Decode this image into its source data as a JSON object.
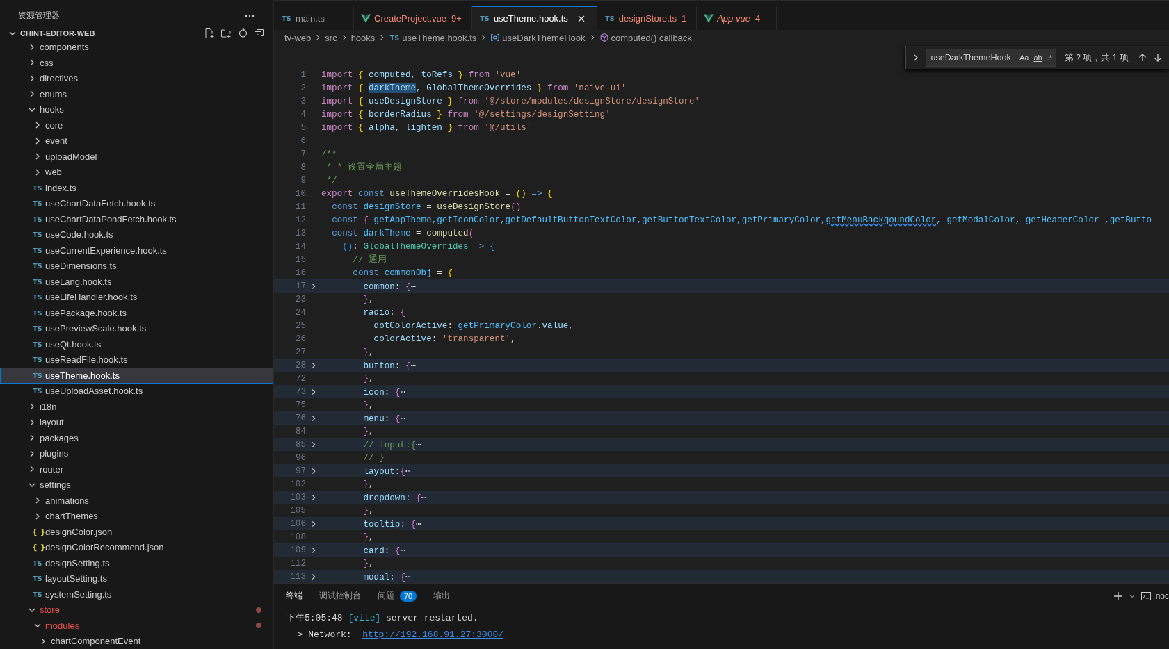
{
  "explorer": {
    "title": "资源管理器",
    "root": {
      "label": "CHINT-EDITOR-WEB",
      "expanded": true
    },
    "tree": [
      {
        "label": "components",
        "kind": "folder",
        "expanded": false,
        "selected": false,
        "modified": false
      },
      {
        "label": "css",
        "kind": "folder",
        "expanded": false,
        "selected": false,
        "modified": false
      },
      {
        "label": "directives",
        "kind": "folder",
        "expanded": false,
        "selected": false,
        "modified": false
      },
      {
        "label": "enums",
        "kind": "folder",
        "expanded": false,
        "selected": false,
        "modified": false
      },
      {
        "label": "hooks",
        "kind": "folder",
        "expanded": true,
        "selected": false,
        "modified": false,
        "children": [
          {
            "label": "core",
            "kind": "folder",
            "expanded": false,
            "selected": false,
            "modified": false
          },
          {
            "label": "event",
            "kind": "folder",
            "expanded": false,
            "selected": false,
            "modified": false
          },
          {
            "label": "uploadModel",
            "kind": "folder",
            "expanded": false,
            "selected": false,
            "modified": false
          },
          {
            "label": "web",
            "kind": "folder",
            "expanded": false,
            "selected": false,
            "modified": false
          },
          {
            "label": "index.ts",
            "kind": "ts",
            "icon": "TS",
            "selected": false,
            "modified": false
          },
          {
            "label": "useChartDataFetch.hook.ts",
            "kind": "ts",
            "icon": "TS",
            "selected": false,
            "modified": false
          },
          {
            "label": "useChartDataPondFetch.hook.ts",
            "kind": "ts",
            "icon": "TS",
            "selected": false,
            "modified": false
          },
          {
            "label": "useCode.hook.ts",
            "kind": "ts",
            "icon": "TS",
            "selected": false,
            "modified": false
          },
          {
            "label": "useCurrentExperience.hook.ts",
            "kind": "ts",
            "icon": "TS",
            "selected": false,
            "modified": false
          },
          {
            "label": "useDimensions.ts",
            "kind": "ts",
            "icon": "TS",
            "selected": false,
            "modified": false
          },
          {
            "label": "useLang.hook.ts",
            "kind": "ts",
            "icon": "TS",
            "selected": false,
            "modified": false
          },
          {
            "label": "useLifeHandler.hook.ts",
            "kind": "ts",
            "icon": "TS",
            "selected": false,
            "modified": false
          },
          {
            "label": "usePackage.hook.ts",
            "kind": "ts",
            "icon": "TS",
            "selected": false,
            "modified": false
          },
          {
            "label": "usePreviewScale.hook.ts",
            "kind": "ts",
            "icon": "TS",
            "selected": false,
            "modified": false
          },
          {
            "label": "useQt.hook.ts",
            "kind": "ts",
            "icon": "TS",
            "selected": false,
            "modified": false
          },
          {
            "label": "useReadFile.hook.ts",
            "kind": "ts",
            "icon": "TS",
            "selected": false,
            "modified": false
          },
          {
            "label": "useTheme.hook.ts",
            "kind": "ts",
            "icon": "TS",
            "selected": true,
            "modified": false
          },
          {
            "label": "useUploadAsset.hook.ts",
            "kind": "ts",
            "icon": "TS",
            "selected": false,
            "modified": false
          }
        ]
      },
      {
        "label": "i18n",
        "kind": "folder",
        "expanded": false,
        "selected": false,
        "modified": false
      },
      {
        "label": "layout",
        "kind": "folder",
        "expanded": false,
        "selected": false,
        "modified": false
      },
      {
        "label": "packages",
        "kind": "folder",
        "expanded": false,
        "selected": false,
        "modified": false
      },
      {
        "label": "plugins",
        "kind": "folder",
        "expanded": false,
        "selected": false,
        "modified": false
      },
      {
        "label": "router",
        "kind": "folder",
        "expanded": false,
        "selected": false,
        "modified": false
      },
      {
        "label": "settings",
        "kind": "folder",
        "expanded": true,
        "selected": false,
        "modified": false,
        "children": [
          {
            "label": "animations",
            "kind": "folder",
            "expanded": false,
            "selected": false,
            "modified": false
          },
          {
            "label": "chartThemes",
            "kind": "folder",
            "expanded": false,
            "selected": false,
            "modified": false
          },
          {
            "label": "designColor.json",
            "kind": "json",
            "icon": "{ }",
            "selected": false,
            "modified": false
          },
          {
            "label": "designColorRecommend.json",
            "kind": "json",
            "icon": "{ }",
            "selected": false,
            "modified": false
          },
          {
            "label": "designSetting.ts",
            "kind": "ts",
            "icon": "TS",
            "selected": false,
            "modified": false
          },
          {
            "label": "layoutSetting.ts",
            "kind": "ts",
            "icon": "TS",
            "selected": false,
            "modified": false
          },
          {
            "label": "systemSetting.ts",
            "kind": "ts",
            "icon": "TS",
            "selected": false,
            "modified": false
          }
        ]
      },
      {
        "label": "store",
        "kind": "folder",
        "expanded": true,
        "selected": false,
        "modified": true,
        "children": [
          {
            "label": "modules",
            "kind": "folder",
            "expanded": true,
            "selected": false,
            "modified": true,
            "children": [
              {
                "label": "chartComponentEvent",
                "kind": "folder",
                "expanded": false,
                "selected": false,
                "modified": false
              }
            ]
          }
        ]
      }
    ]
  },
  "tabs": [
    {
      "label": "main.ts",
      "kind": "ts",
      "icon": "TS",
      "selected": false,
      "error": false,
      "preview": false
    },
    {
      "label": "CreateProject.vue",
      "kind": "vue",
      "badge": "9+",
      "selected": false,
      "error": true,
      "preview": false
    },
    {
      "label": "useTheme.hook.ts",
      "kind": "ts",
      "icon": "TS",
      "selected": true,
      "error": false,
      "preview": false
    },
    {
      "label": "designStore.ts",
      "kind": "ts",
      "icon": "TS",
      "badge": "1",
      "selected": false,
      "error": true,
      "preview": false
    },
    {
      "label": "App.vue",
      "kind": "vue",
      "badge": "4",
      "selected": false,
      "error": true,
      "preview": true
    }
  ],
  "breadcrumb": [
    {
      "label": "tv-web",
      "kind": "folder"
    },
    {
      "label": "src",
      "kind": "folder"
    },
    {
      "label": "hooks",
      "kind": "folder"
    },
    {
      "label": "useTheme.hook.ts",
      "kind": "ts",
      "icon": "TS"
    },
    {
      "label": "useDarkThemeHook",
      "kind": "variable"
    },
    {
      "label": "computed() callback",
      "kind": "method"
    }
  ],
  "find": {
    "value": "useDarkThemeHook",
    "options": [
      "Aa",
      "ab",
      ".*"
    ],
    "result": "第？项，共 1 项"
  },
  "editor": {
    "lines": [
      {
        "n": "1",
        "folded": false,
        "tokens": [
          {
            "text": "import ",
            "kind": "kw"
          },
          {
            "text": "{",
            "kind": "b1"
          },
          {
            "text": " computed, toRefs ",
            "kind": "var"
          },
          {
            "text": "}",
            "kind": "b1"
          },
          {
            "text": " from ",
            "kind": "kw"
          },
          {
            "text": "'vue'",
            "kind": "str"
          }
        ]
      },
      {
        "n": "2",
        "folded": false,
        "tokens": [
          {
            "text": "import ",
            "kind": "kw"
          },
          {
            "text": "{ ",
            "kind": "b1"
          },
          {
            "text": "darkTheme",
            "kind": "match"
          },
          {
            "text": ", GlobalThemeOverrides ",
            "kind": "var"
          },
          {
            "text": "}",
            "kind": "b1"
          },
          {
            "text": " from ",
            "kind": "kw"
          },
          {
            "text": "'naive-ui'",
            "kind": "str"
          }
        ]
      },
      {
        "n": "3",
        "folded": false,
        "tokens": [
          {
            "text": "import ",
            "kind": "kw"
          },
          {
            "text": "{",
            "kind": "b1"
          },
          {
            "text": " useDesignStore ",
            "kind": "var"
          },
          {
            "text": "}",
            "kind": "b1"
          },
          {
            "text": " from ",
            "kind": "kw"
          },
          {
            "text": "'@/store/modules/designStore/designStore'",
            "kind": "str"
          }
        ]
      },
      {
        "n": "4",
        "folded": false,
        "tokens": [
          {
            "text": "import ",
            "kind": "kw"
          },
          {
            "text": "{",
            "kind": "b1"
          },
          {
            "text": " borderRadius ",
            "kind": "var"
          },
          {
            "text": "}",
            "kind": "b1"
          },
          {
            "text": " from ",
            "kind": "kw"
          },
          {
            "text": "'@/settings/designSetting'",
            "kind": "str"
          }
        ]
      },
      {
        "n": "5",
        "folded": false,
        "tokens": [
          {
            "text": "import ",
            "kind": "kw"
          },
          {
            "text": "{",
            "kind": "b1"
          },
          {
            "text": " alpha, lighten ",
            "kind": "var"
          },
          {
            "text": "}",
            "kind": "b1"
          },
          {
            "text": " from ",
            "kind": "kw"
          },
          {
            "text": "'@/utils'",
            "kind": "str"
          }
        ]
      },
      {
        "n": "6",
        "folded": false
      },
      {
        "n": "7",
        "folded": false,
        "tokens": [
          {
            "text": "/**",
            "kind": "cm"
          }
        ]
      },
      {
        "n": "8",
        "folded": false,
        "tokens": [
          {
            "text": " * * 设置全局主题",
            "kind": "cm"
          }
        ]
      },
      {
        "n": "9",
        "folded": false,
        "tokens": [
          {
            "text": " */",
            "kind": "cm"
          }
        ]
      },
      {
        "n": "10",
        "folded": false,
        "tokens": [
          {
            "text": "export ",
            "kind": "kw"
          },
          {
            "text": "const ",
            "kind": "st"
          },
          {
            "text": "useThemeOverridesHook",
            "kind": "fn"
          },
          {
            "text": " = ",
            "kind": "p"
          },
          {
            "text": "()",
            "kind": "b1"
          },
          {
            "text": " => ",
            "kind": "st"
          },
          {
            "text": "{",
            "kind": "b1"
          }
        ]
      },
      {
        "n": "11",
        "folded": false,
        "tokens": [
          {
            "text": "  const ",
            "kind": "st"
          },
          {
            "text": "designStore",
            "kind": "const"
          },
          {
            "text": " = ",
            "kind": "p"
          },
          {
            "text": "useDesignStore",
            "kind": "fn"
          },
          {
            "text": "()",
            "kind": "b2"
          }
        ]
      },
      {
        "n": "12",
        "folded": false,
        "tokens": [
          {
            "text": "  const ",
            "kind": "st"
          },
          {
            "text": "{",
            "kind": "b2"
          },
          {
            "text": " getAppTheme,getIconColor,getDefaultButtonTextColor,getButtonTextColor,getPrimaryColor,",
            "kind": "const"
          },
          {
            "text": "getMenuBackgoundColor",
            "kind": "misspelled"
          },
          {
            "text": ", getModalColor, getHeaderColor ,getButto",
            "kind": "const"
          }
        ]
      },
      {
        "n": "13",
        "folded": false,
        "tokens": [
          {
            "text": "  const ",
            "kind": "st"
          },
          {
            "text": "darkTheme",
            "kind": "const"
          },
          {
            "text": " = ",
            "kind": "p"
          },
          {
            "text": "computed",
            "kind": "fn"
          },
          {
            "text": "(",
            "kind": "b2"
          }
        ]
      },
      {
        "n": "14",
        "folded": false,
        "tokens": [
          {
            "text": "    ()",
            "kind": "b3"
          },
          {
            "text": ": ",
            "kind": "p"
          },
          {
            "text": "GlobalThemeOverrides",
            "kind": "type"
          },
          {
            "text": " => ",
            "kind": "st"
          },
          {
            "text": "{",
            "kind": "b3"
          }
        ]
      },
      {
        "n": "15",
        "folded": false,
        "tokens": [
          {
            "text": "      // 通用",
            "kind": "cm"
          }
        ]
      },
      {
        "n": "16",
        "folded": false,
        "tokens": [
          {
            "text": "      const ",
            "kind": "st"
          },
          {
            "text": "commonObj",
            "kind": "const"
          },
          {
            "text": " = ",
            "kind": "p"
          },
          {
            "text": "{",
            "kind": "b1"
          }
        ]
      },
      {
        "n": "17",
        "folded": true,
        "tokens": [
          {
            "text": "        common",
            "kind": "var"
          },
          {
            "text": ": ",
            "kind": "p"
          },
          {
            "text": "{",
            "kind": "b2"
          },
          {
            "text": "⋯",
            "kind": "p"
          }
        ]
      },
      {
        "n": "23",
        "folded": false,
        "tokens": [
          {
            "text": "        }",
            "kind": "b2"
          },
          {
            "text": ",",
            "kind": "p"
          }
        ]
      },
      {
        "n": "24",
        "folded": false,
        "tokens": [
          {
            "text": "        radio",
            "kind": "var"
          },
          {
            "text": ": ",
            "kind": "p"
          },
          {
            "text": "{",
            "kind": "b2"
          }
        ]
      },
      {
        "n": "25",
        "folded": false,
        "tokens": [
          {
            "text": "          dotColorActive",
            "kind": "var"
          },
          {
            "text": ": ",
            "kind": "p"
          },
          {
            "text": "getPrimaryColor",
            "kind": "const"
          },
          {
            "text": ".",
            "kind": "p"
          },
          {
            "text": "value",
            "kind": "var"
          },
          {
            "text": ",",
            "kind": "p"
          }
        ]
      },
      {
        "n": "26",
        "folded": false,
        "tokens": [
          {
            "text": "          colorActive",
            "kind": "var"
          },
          {
            "text": ": ",
            "kind": "p"
          },
          {
            "text": "'transparent'",
            "kind": "str"
          },
          {
            "text": ",",
            "kind": "p"
          }
        ]
      },
      {
        "n": "27",
        "folded": false,
        "tokens": [
          {
            "text": "        }",
            "kind": "b2"
          },
          {
            "text": ",",
            "kind": "p"
          }
        ]
      },
      {
        "n": "28",
        "folded": true,
        "tokens": [
          {
            "text": "        button",
            "kind": "var"
          },
          {
            "text": ": ",
            "kind": "p"
          },
          {
            "text": "{",
            "kind": "b2"
          },
          {
            "text": "⋯",
            "kind": "p"
          }
        ]
      },
      {
        "n": "72",
        "folded": false,
        "tokens": [
          {
            "text": "        }",
            "kind": "b2"
          },
          {
            "text": ",",
            "kind": "p"
          }
        ]
      },
      {
        "n": "73",
        "folded": true,
        "tokens": [
          {
            "text": "        icon",
            "kind": "var"
          },
          {
            "text": ": ",
            "kind": "p"
          },
          {
            "text": "{",
            "kind": "b2"
          },
          {
            "text": "⋯",
            "kind": "p"
          }
        ]
      },
      {
        "n": "75",
        "folded": false,
        "tokens": [
          {
            "text": "        }",
            "kind": "b2"
          },
          {
            "text": ",",
            "kind": "p"
          }
        ]
      },
      {
        "n": "76",
        "folded": true,
        "tokens": [
          {
            "text": "        menu",
            "kind": "var"
          },
          {
            "text": ": ",
            "kind": "p"
          },
          {
            "text": "{",
            "kind": "b2"
          },
          {
            "text": "⋯",
            "kind": "p"
          }
        ]
      },
      {
        "n": "84",
        "folded": false,
        "tokens": [
          {
            "text": "        }",
            "kind": "b2"
          },
          {
            "text": ",",
            "kind": "p"
          }
        ]
      },
      {
        "n": "85",
        "folded": true,
        "tokens": [
          {
            "text": "        // input:{",
            "kind": "cm"
          },
          {
            "text": "⋯",
            "kind": "p"
          }
        ]
      },
      {
        "n": "96",
        "folded": false,
        "tokens": [
          {
            "text": "        // }",
            "kind": "cm"
          }
        ]
      },
      {
        "n": "97",
        "folded": true,
        "tokens": [
          {
            "text": "        layout",
            "kind": "var"
          },
          {
            "text": ":",
            "kind": "p"
          },
          {
            "text": "{",
            "kind": "b2"
          },
          {
            "text": "⋯",
            "kind": "p"
          }
        ]
      },
      {
        "n": "102",
        "folded": false,
        "tokens": [
          {
            "text": "        }",
            "kind": "b2"
          },
          {
            "text": ",",
            "kind": "p"
          }
        ]
      },
      {
        "n": "103",
        "folded": true,
        "tokens": [
          {
            "text": "        dropdown",
            "kind": "var"
          },
          {
            "text": ": ",
            "kind": "p"
          },
          {
            "text": "{",
            "kind": "b2"
          },
          {
            "text": "⋯",
            "kind": "p"
          }
        ]
      },
      {
        "n": "105",
        "folded": false,
        "tokens": [
          {
            "text": "        }",
            "kind": "b2"
          },
          {
            "text": ",",
            "kind": "p"
          }
        ]
      },
      {
        "n": "106",
        "folded": true,
        "tokens": [
          {
            "text": "        tooltip",
            "kind": "var"
          },
          {
            "text": ": ",
            "kind": "p"
          },
          {
            "text": "{",
            "kind": "b2"
          },
          {
            "text": "⋯",
            "kind": "p"
          }
        ]
      },
      {
        "n": "108",
        "folded": false,
        "tokens": [
          {
            "text": "        }",
            "kind": "b2"
          },
          {
            "text": ",",
            "kind": "p"
          }
        ]
      },
      {
        "n": "109",
        "folded": true,
        "tokens": [
          {
            "text": "        card",
            "kind": "var"
          },
          {
            "text": ": ",
            "kind": "p"
          },
          {
            "text": "{",
            "kind": "b2"
          },
          {
            "text": "⋯",
            "kind": "p"
          }
        ]
      },
      {
        "n": "112",
        "folded": false,
        "tokens": [
          {
            "text": "        }",
            "kind": "b2"
          },
          {
            "text": ",",
            "kind": "p"
          }
        ]
      },
      {
        "n": "113",
        "folded": true,
        "tokens": [
          {
            "text": "        modal",
            "kind": "var"
          },
          {
            "text": ": ",
            "kind": "p"
          },
          {
            "text": "{",
            "kind": "b2"
          },
          {
            "text": "⋯",
            "kind": "p"
          }
        ]
      }
    ]
  },
  "panel": {
    "tabs": [
      {
        "label": "终端",
        "selected": true
      },
      {
        "label": "调试控制台",
        "selected": false
      },
      {
        "label": "问题",
        "selected": false,
        "badge": "70"
      },
      {
        "label": "输出",
        "selected": false
      }
    ],
    "terminal_name": "noc",
    "output": [
      [
        {
          "text": "下午5:05:48 ",
          "kind": "p"
        },
        {
          "text": "[vite]",
          "kind": "vite"
        },
        {
          "text": " server restarted.",
          "kind": "p"
        }
      ],
      [
        {
          "text": "  > Network:  ",
          "kind": "p"
        },
        {
          "text": "http://192.168.91.27:3000/",
          "kind": "link"
        }
      ]
    ]
  }
}
